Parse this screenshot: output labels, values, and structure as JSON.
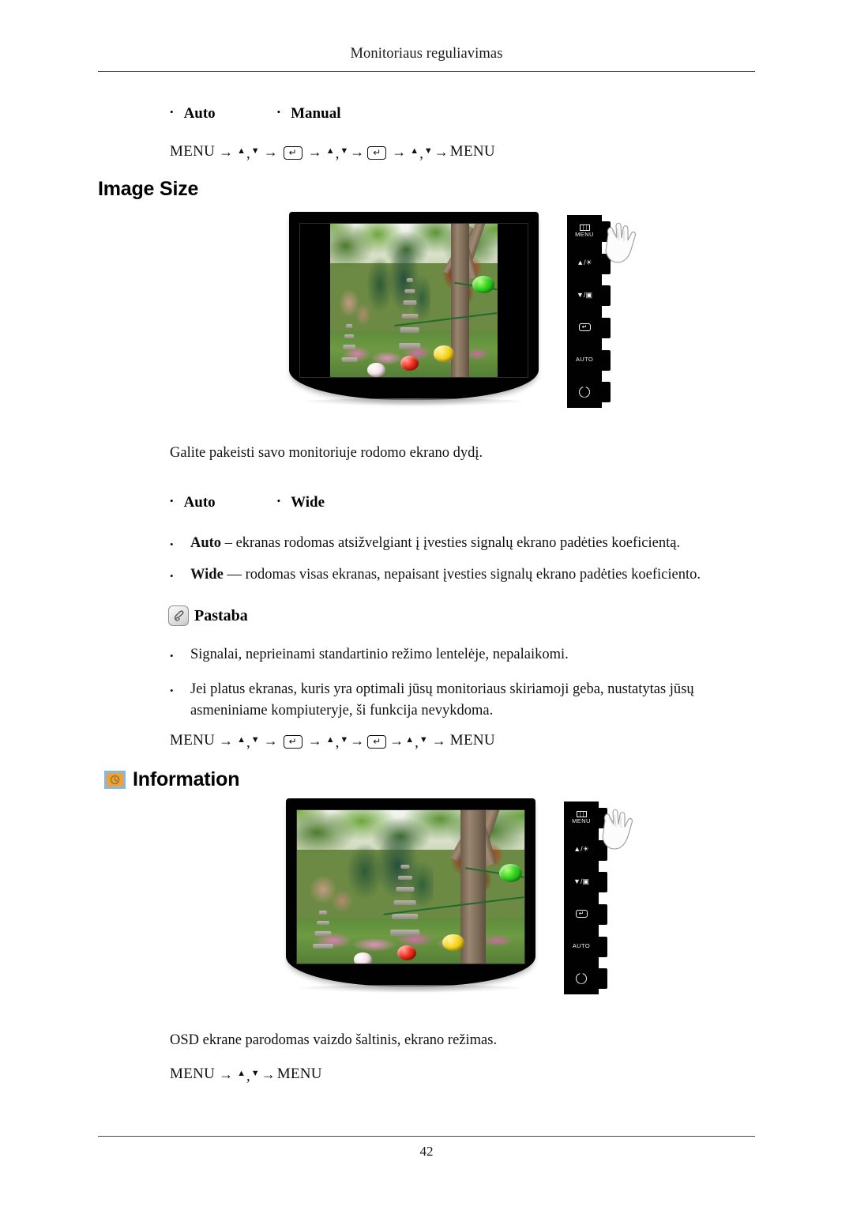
{
  "header": {
    "running_title": "Monitoriaus reguliavimas"
  },
  "footer": {
    "page_number": "42"
  },
  "top_section": {
    "options": [
      {
        "label": "Auto"
      },
      {
        "label": "Manual"
      }
    ],
    "menu_sequence": {
      "start": "MENU",
      "end": "MENU",
      "up": "▲",
      "down": "▼",
      "comma": ",",
      "arrow": "→",
      "enter": "↵"
    }
  },
  "image_size_section": {
    "heading": "Image Size",
    "description": "Galite pakeisti savo monitoriuje rodomo ekrano dydį.",
    "options": [
      {
        "label": "Auto"
      },
      {
        "label": "Wide"
      }
    ],
    "details": [
      {
        "term": "Auto",
        "text": " – ekranas rodomas atsižvelgiant į įvesties signalų ekrano padėties koeficientą."
      },
      {
        "term": "Wide",
        "text": " — rodomas visas ekranas, nepaisant įvesties signalų ekrano padėties koeficiento."
      }
    ],
    "note": {
      "icon": "note-hand-icon",
      "label": "Pastaba",
      "items": [
        "Signalai, neprieinami standartinio režimo lentelėje, nepalaikomi.",
        "Jei platus ekranas, kuris yra optimali jūsų monitoriaus skiriamoji geba, nustatytas jūsų asmeniniame kompiuteryje, ši funkcija nevykdoma."
      ]
    },
    "menu_sequence": {
      "start": "MENU",
      "end": "MENU",
      "up": "▲",
      "down": "▼",
      "comma": ",",
      "arrow": "→",
      "enter": "↵"
    }
  },
  "information_section": {
    "icon": "information-clock-icon",
    "heading": "Information",
    "description": "OSD ekrane parodomas vaizdo šaltinis, ekrano režimas.",
    "menu_sequence": {
      "start": "MENU",
      "end": "MENU",
      "up": "▲",
      "down": "▼",
      "comma": ",",
      "arrow": "→"
    }
  },
  "monitor_figures": [
    {
      "name": "image-size-monitor",
      "screen_mode": "pillarboxed",
      "buttons": [
        {
          "name": "menu-button",
          "label": "MENU",
          "icon": "menu-bars-icon"
        },
        {
          "name": "up-brightness-button",
          "label": "▲/☀",
          "icon": "up-brightness-icon"
        },
        {
          "name": "down-image-button",
          "label": "▼/▣",
          "icon": "down-image-icon"
        },
        {
          "name": "enter-button",
          "label": "↵",
          "icon": "enter-key-icon"
        },
        {
          "name": "auto-button",
          "label": "AUTO",
          "icon": "auto-text-icon"
        },
        {
          "name": "power-button",
          "label": "⏻",
          "icon": "power-icon"
        }
      ]
    },
    {
      "name": "information-monitor",
      "screen_mode": "full",
      "buttons": [
        {
          "name": "menu-button",
          "label": "MENU",
          "icon": "menu-bars-icon"
        },
        {
          "name": "up-brightness-button",
          "label": "▲/☀",
          "icon": "up-brightness-icon"
        },
        {
          "name": "down-image-button",
          "label": "▼/▣",
          "icon": "down-image-icon"
        },
        {
          "name": "enter-button",
          "label": "↵",
          "icon": "enter-key-icon"
        },
        {
          "name": "auto-button",
          "label": "AUTO",
          "icon": "auto-text-icon"
        },
        {
          "name": "power-button",
          "label": "⏻",
          "icon": "power-icon"
        }
      ]
    }
  ],
  "colors": {
    "info_icon_fill": "#f0a03c",
    "info_icon_border": "#86b9dd",
    "bezel": "#010101",
    "rule": "#4a4a4a"
  }
}
